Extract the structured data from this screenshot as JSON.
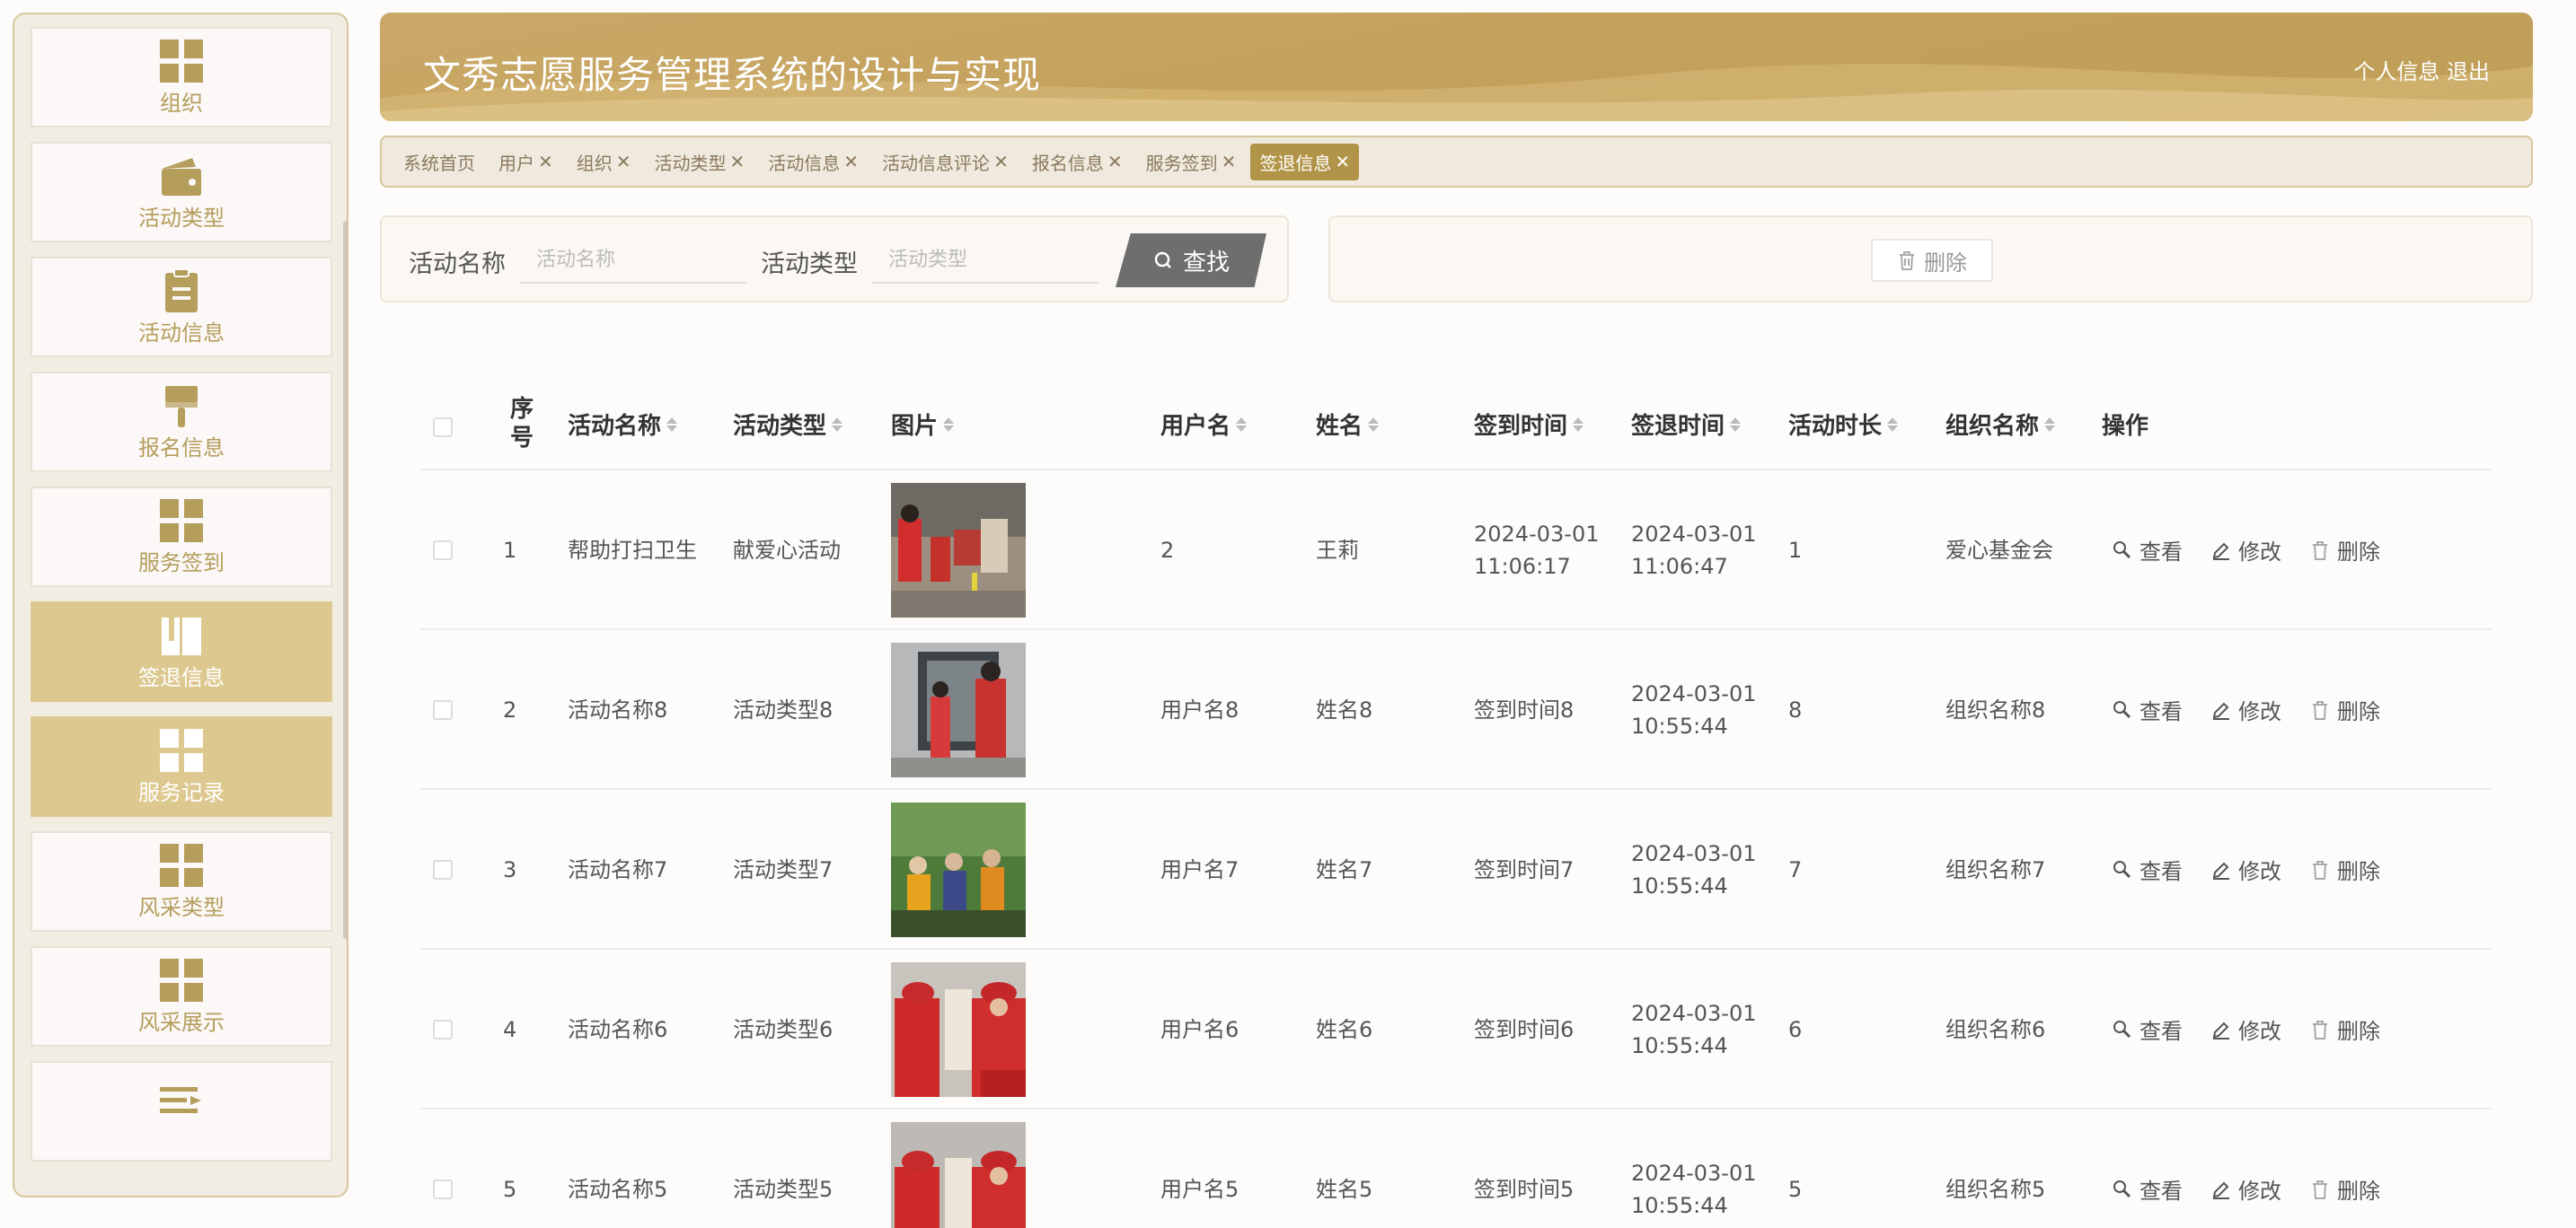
{
  "header": {
    "title": "文秀志愿服务管理系统的设计与实现",
    "profile_link": "个人信息",
    "logout_link": "退出"
  },
  "sidebar": {
    "items": [
      {
        "label": "组织",
        "icon": "grid-icon"
      },
      {
        "label": "活动类型",
        "icon": "wallet-icon"
      },
      {
        "label": "活动信息",
        "icon": "clipboard-icon"
      },
      {
        "label": "报名信息",
        "icon": "brush-icon"
      },
      {
        "label": "服务签到",
        "icon": "grid-icon"
      },
      {
        "label": "签退信息",
        "icon": "book-icon"
      },
      {
        "label": "服务记录",
        "icon": "grid-icon"
      },
      {
        "label": "风采类型",
        "icon": "grid-icon"
      },
      {
        "label": "风采展示",
        "icon": "grid-icon"
      },
      {
        "label": "",
        "icon": "list-icon"
      }
    ],
    "active_index": 5
  },
  "tabs": [
    {
      "label": "系统首页",
      "closable": false
    },
    {
      "label": "用户",
      "closable": true
    },
    {
      "label": "组织",
      "closable": true
    },
    {
      "label": "活动类型",
      "closable": true
    },
    {
      "label": "活动信息",
      "closable": true
    },
    {
      "label": "活动信息评论",
      "closable": true
    },
    {
      "label": "报名信息",
      "closable": true
    },
    {
      "label": "服务签到",
      "closable": true
    },
    {
      "label": "签退信息",
      "closable": true,
      "active": true
    }
  ],
  "search": {
    "activity_name_label": "活动名称",
    "activity_name_placeholder": "活动名称",
    "activity_type_label": "活动类型",
    "activity_type_placeholder": "活动类型",
    "button_label": "查找"
  },
  "actions": {
    "delete_label": "删除"
  },
  "table": {
    "columns": [
      "序号",
      "活动名称",
      "活动类型",
      "图片",
      "用户名",
      "姓名",
      "签到时间",
      "签退时间",
      "活动时长",
      "组织名称",
      "操作"
    ],
    "rows": [
      {
        "index": "1",
        "activity_name": "帮助打扫卫生",
        "activity_type": "献爱心活动",
        "username": "2",
        "name": "王莉",
        "checkin_date": "2024-03-01",
        "checkin_time": "11:06:17",
        "checkout_date": "2024-03-01",
        "checkout_time": "11:06:47",
        "duration": "1",
        "org": "爱心基金会"
      },
      {
        "index": "2",
        "activity_name": "活动名称8",
        "activity_type": "活动类型8",
        "username": "用户名8",
        "name": "姓名8",
        "checkin_date": "签到时间8",
        "checkin_time": "",
        "checkout_date": "2024-03-01",
        "checkout_time": "10:55:44",
        "duration": "8",
        "org": "组织名称8"
      },
      {
        "index": "3",
        "activity_name": "活动名称7",
        "activity_type": "活动类型7",
        "username": "用户名7",
        "name": "姓名7",
        "checkin_date": "签到时间7",
        "checkin_time": "",
        "checkout_date": "2024-03-01",
        "checkout_time": "10:55:44",
        "duration": "7",
        "org": "组织名称7"
      },
      {
        "index": "4",
        "activity_name": "活动名称6",
        "activity_type": "活动类型6",
        "username": "用户名6",
        "name": "姓名6",
        "checkin_date": "签到时间6",
        "checkin_time": "",
        "checkout_date": "2024-03-01",
        "checkout_time": "10:55:44",
        "duration": "6",
        "org": "组织名称6"
      },
      {
        "index": "5",
        "activity_name": "活动名称5",
        "activity_type": "活动类型5",
        "username": "用户名5",
        "name": "姓名5",
        "checkin_date": "签到时间5",
        "checkin_time": "",
        "checkout_date": "2024-03-01",
        "checkout_time": "10:55:44",
        "duration": "5",
        "org": "组织名称5"
      }
    ],
    "row_actions": {
      "view": "查看",
      "edit": "修改",
      "delete": "删除"
    }
  },
  "colors": {
    "accent": "#c4a25c",
    "active_menu": "#ddc990",
    "active_tab": "#b19447",
    "menu_icon": "#b59d5c"
  }
}
